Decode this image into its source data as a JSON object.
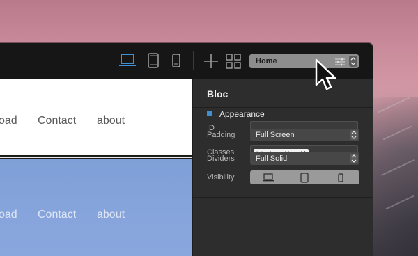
{
  "toolbar": {
    "page_select": {
      "value": "Home"
    }
  },
  "canvas": {
    "nav_top": [
      "oad",
      "Contact",
      "about"
    ],
    "nav_blue": [
      "oad",
      "Contact",
      "about"
    ]
  },
  "panel": {
    "title": "Bloc",
    "id_label": "ID",
    "id_value": "",
    "classes_label": "Classes",
    "class_tag": "lake-hero-bloc",
    "class_tag_remove": "✕",
    "visibility_label": "Visibility",
    "appearance_label": "Appearance",
    "padding_label": "Padding",
    "padding_value": "Full Screen",
    "dividers_label": "Dividers",
    "dividers_value": "Full Solid"
  },
  "colors": {
    "accent": "#3f8fd1",
    "panel_bg": "#2d2d2d",
    "toolbar_bg": "#161616",
    "canvas_blue": "#87a5dc"
  },
  "icons": [
    "laptop-icon",
    "tablet-icon",
    "phone-icon",
    "plus-icon",
    "grid-icon",
    "sliders-icon",
    "chevron-updown-icon",
    "cursor-icon"
  ]
}
